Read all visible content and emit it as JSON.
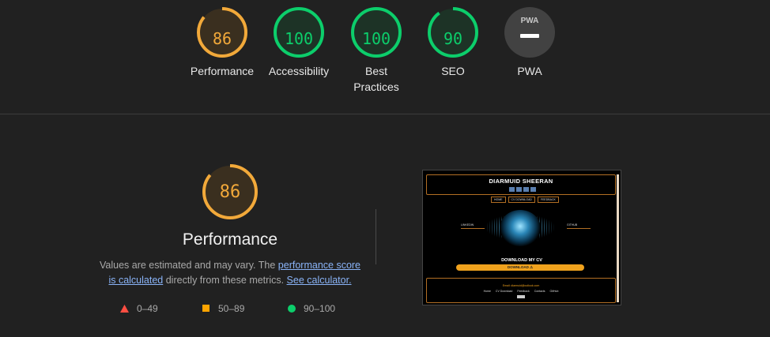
{
  "colors": {
    "average": "#ffa400",
    "pass": "#0cce6b",
    "fail": "#ff4e42",
    "pwa": "#9e9e9e"
  },
  "gauges": [
    {
      "score": "86",
      "label": "Performance",
      "value": 86,
      "color": "#f2a93a"
    },
    {
      "score": "100",
      "label": "Accessibility",
      "value": 100,
      "color": "#0cce6b"
    },
    {
      "score": "100",
      "label_1": "Best",
      "label_2": "Practices",
      "value": 100,
      "color": "#0cce6b"
    },
    {
      "score": "90",
      "label": "SEO",
      "value": 90,
      "color": "#0cce6b"
    },
    {
      "badge": "PWA",
      "label": "PWA",
      "icon": "dash-icon"
    }
  ],
  "performance": {
    "score": "86",
    "value": 86,
    "title": "Performance",
    "desc_part1": "Values are estimated and may vary. The ",
    "link_score": "performance score is calculated",
    "desc_part2": " directly from these metrics. ",
    "link_calc": "See calculator."
  },
  "legend": [
    {
      "range": "0–49",
      "icon": "triangle-icon"
    },
    {
      "range": "50–89",
      "icon": "square-icon"
    },
    {
      "range": "90–100",
      "icon": "circle-icon"
    }
  ],
  "screenshot": {
    "site_title": "DIARMUID SHEERAN",
    "nav": [
      "HOME",
      "CV DOWNLOAD",
      "FEEDBACK"
    ],
    "side_left": "LINKEDIN",
    "side_right": "GITHUB",
    "download_heading": "DOWNLOAD MY CV",
    "download_button": "DOWNLOAD ⚠",
    "email": "Email: diarmuid@outlook.com",
    "footer_links": [
      "Home",
      "CV Download",
      "Feedback",
      "Contacts",
      "GitHub"
    ]
  }
}
